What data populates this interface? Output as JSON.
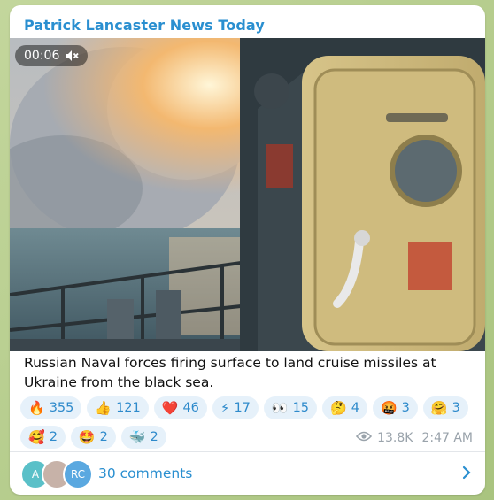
{
  "channel": {
    "name": "Patrick Lancaster News Today"
  },
  "video": {
    "timer": "00:06",
    "mute_icon": "speaker-muted-icon"
  },
  "post": {
    "caption": "Russian Naval forces firing surface to land cruise missiles at Ukraine from the black sea."
  },
  "reactions": [
    {
      "emoji": "🔥",
      "count": "355"
    },
    {
      "emoji": "👍",
      "count": "121"
    },
    {
      "emoji": "❤️",
      "count": "46"
    },
    {
      "emoji": "⚡",
      "count": "17"
    },
    {
      "emoji": "👀",
      "count": "15"
    },
    {
      "emoji": "🤔",
      "count": "4"
    },
    {
      "emoji": "🤬",
      "count": "3"
    },
    {
      "emoji": "🤗",
      "count": "3"
    },
    {
      "emoji": "🥰",
      "count": "2"
    },
    {
      "emoji": "🤩",
      "count": "2"
    },
    {
      "emoji": "🐳",
      "count": "2"
    }
  ],
  "meta": {
    "views": "13.8K",
    "time": "2:47 AM"
  },
  "comments": {
    "label": "30 comments",
    "avatars": [
      {
        "initials": "A",
        "color": "#5ac0c8"
      },
      {
        "initials": "",
        "color": "#c7b2a8"
      },
      {
        "initials": "RC",
        "color": "#5aa8e0"
      }
    ]
  },
  "colors": {
    "accent": "#2a8fd0",
    "reaction_bg": "#e6f1fa"
  }
}
